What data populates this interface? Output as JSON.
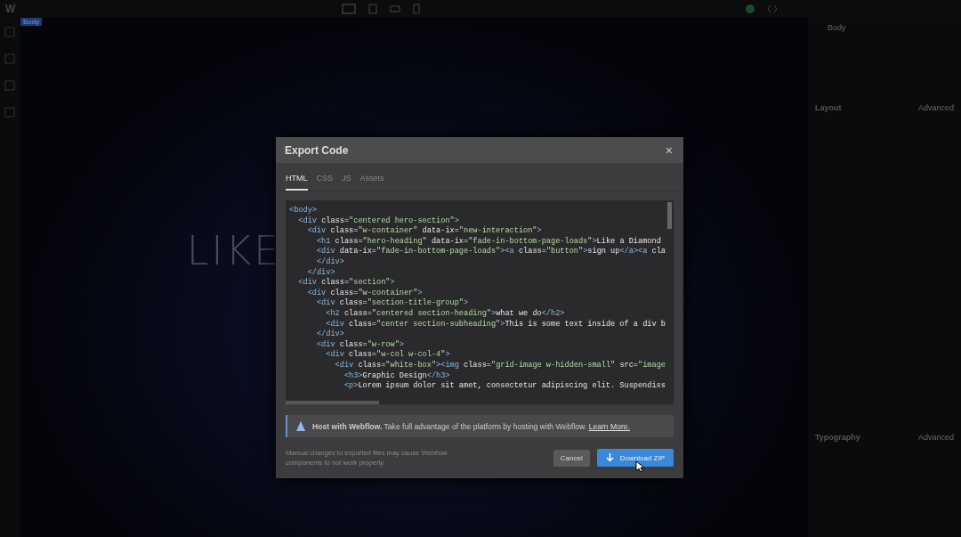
{
  "app": {
    "logo": "W"
  },
  "canvas": {
    "element_tag": "Body",
    "hero_text": "LIKE"
  },
  "style_panel": {
    "element": "Body",
    "sections": [
      {
        "title": "Layout",
        "advanced": "Advanced"
      },
      {
        "title": "Typography",
        "advanced": "Advanced"
      }
    ]
  },
  "dialog": {
    "title": "Export Code",
    "close": "×",
    "tabs": [
      {
        "label": "HTML",
        "selected": true
      },
      {
        "label": "CSS",
        "selected": false
      },
      {
        "label": "JS",
        "selected": false
      },
      {
        "label": "Assets",
        "selected": false
      }
    ],
    "code_lines": [
      "<body>",
      "  <div class=\"centered hero-section\">",
      "    <div class=\"w-container\" data-ix=\"new-interaction\">",
      "      <h1 class=\"hero-heading\" data-ix=\"fade-in-bottom-page-loads\">Like a Diamond",
      "      <div data-ix=\"fade-in-bottom-page-loads\"><a class=\"button\">sign up</a><a cla",
      "      </div>",
      "    </div>",
      "  <div class=\"section\">",
      "    <div class=\"w-container\">",
      "      <div class=\"section-title-group\">",
      "        <h2 class=\"centered section-heading\">what we do</h2>",
      "        <div class=\"center section-subheading\">This is some text inside of a div b",
      "      </div>",
      "      <div class=\"w-row\">",
      "        <div class=\"w-col w-col-4\">",
      "          <div class=\"white-box\"><img class=\"grid-image w-hidden-small\" src=\"image",
      "            <h3>Graphic Design</h3>",
      "            <p>Lorem ipsum dolor sit amet, consectetur adipiscing elit. Suspendiss"
    ],
    "banner": {
      "text": "**Host with Webflow.** Take full advantage of the platform by hosting with Webflow.",
      "link": "Learn More."
    },
    "note": "Manual changes to exported files may cause Webflow components to not work properly.",
    "buttons": [
      {
        "label": "Cancel",
        "kind": "secondary"
      },
      {
        "label": "Download ZIP",
        "kind": "primary"
      }
    ]
  }
}
